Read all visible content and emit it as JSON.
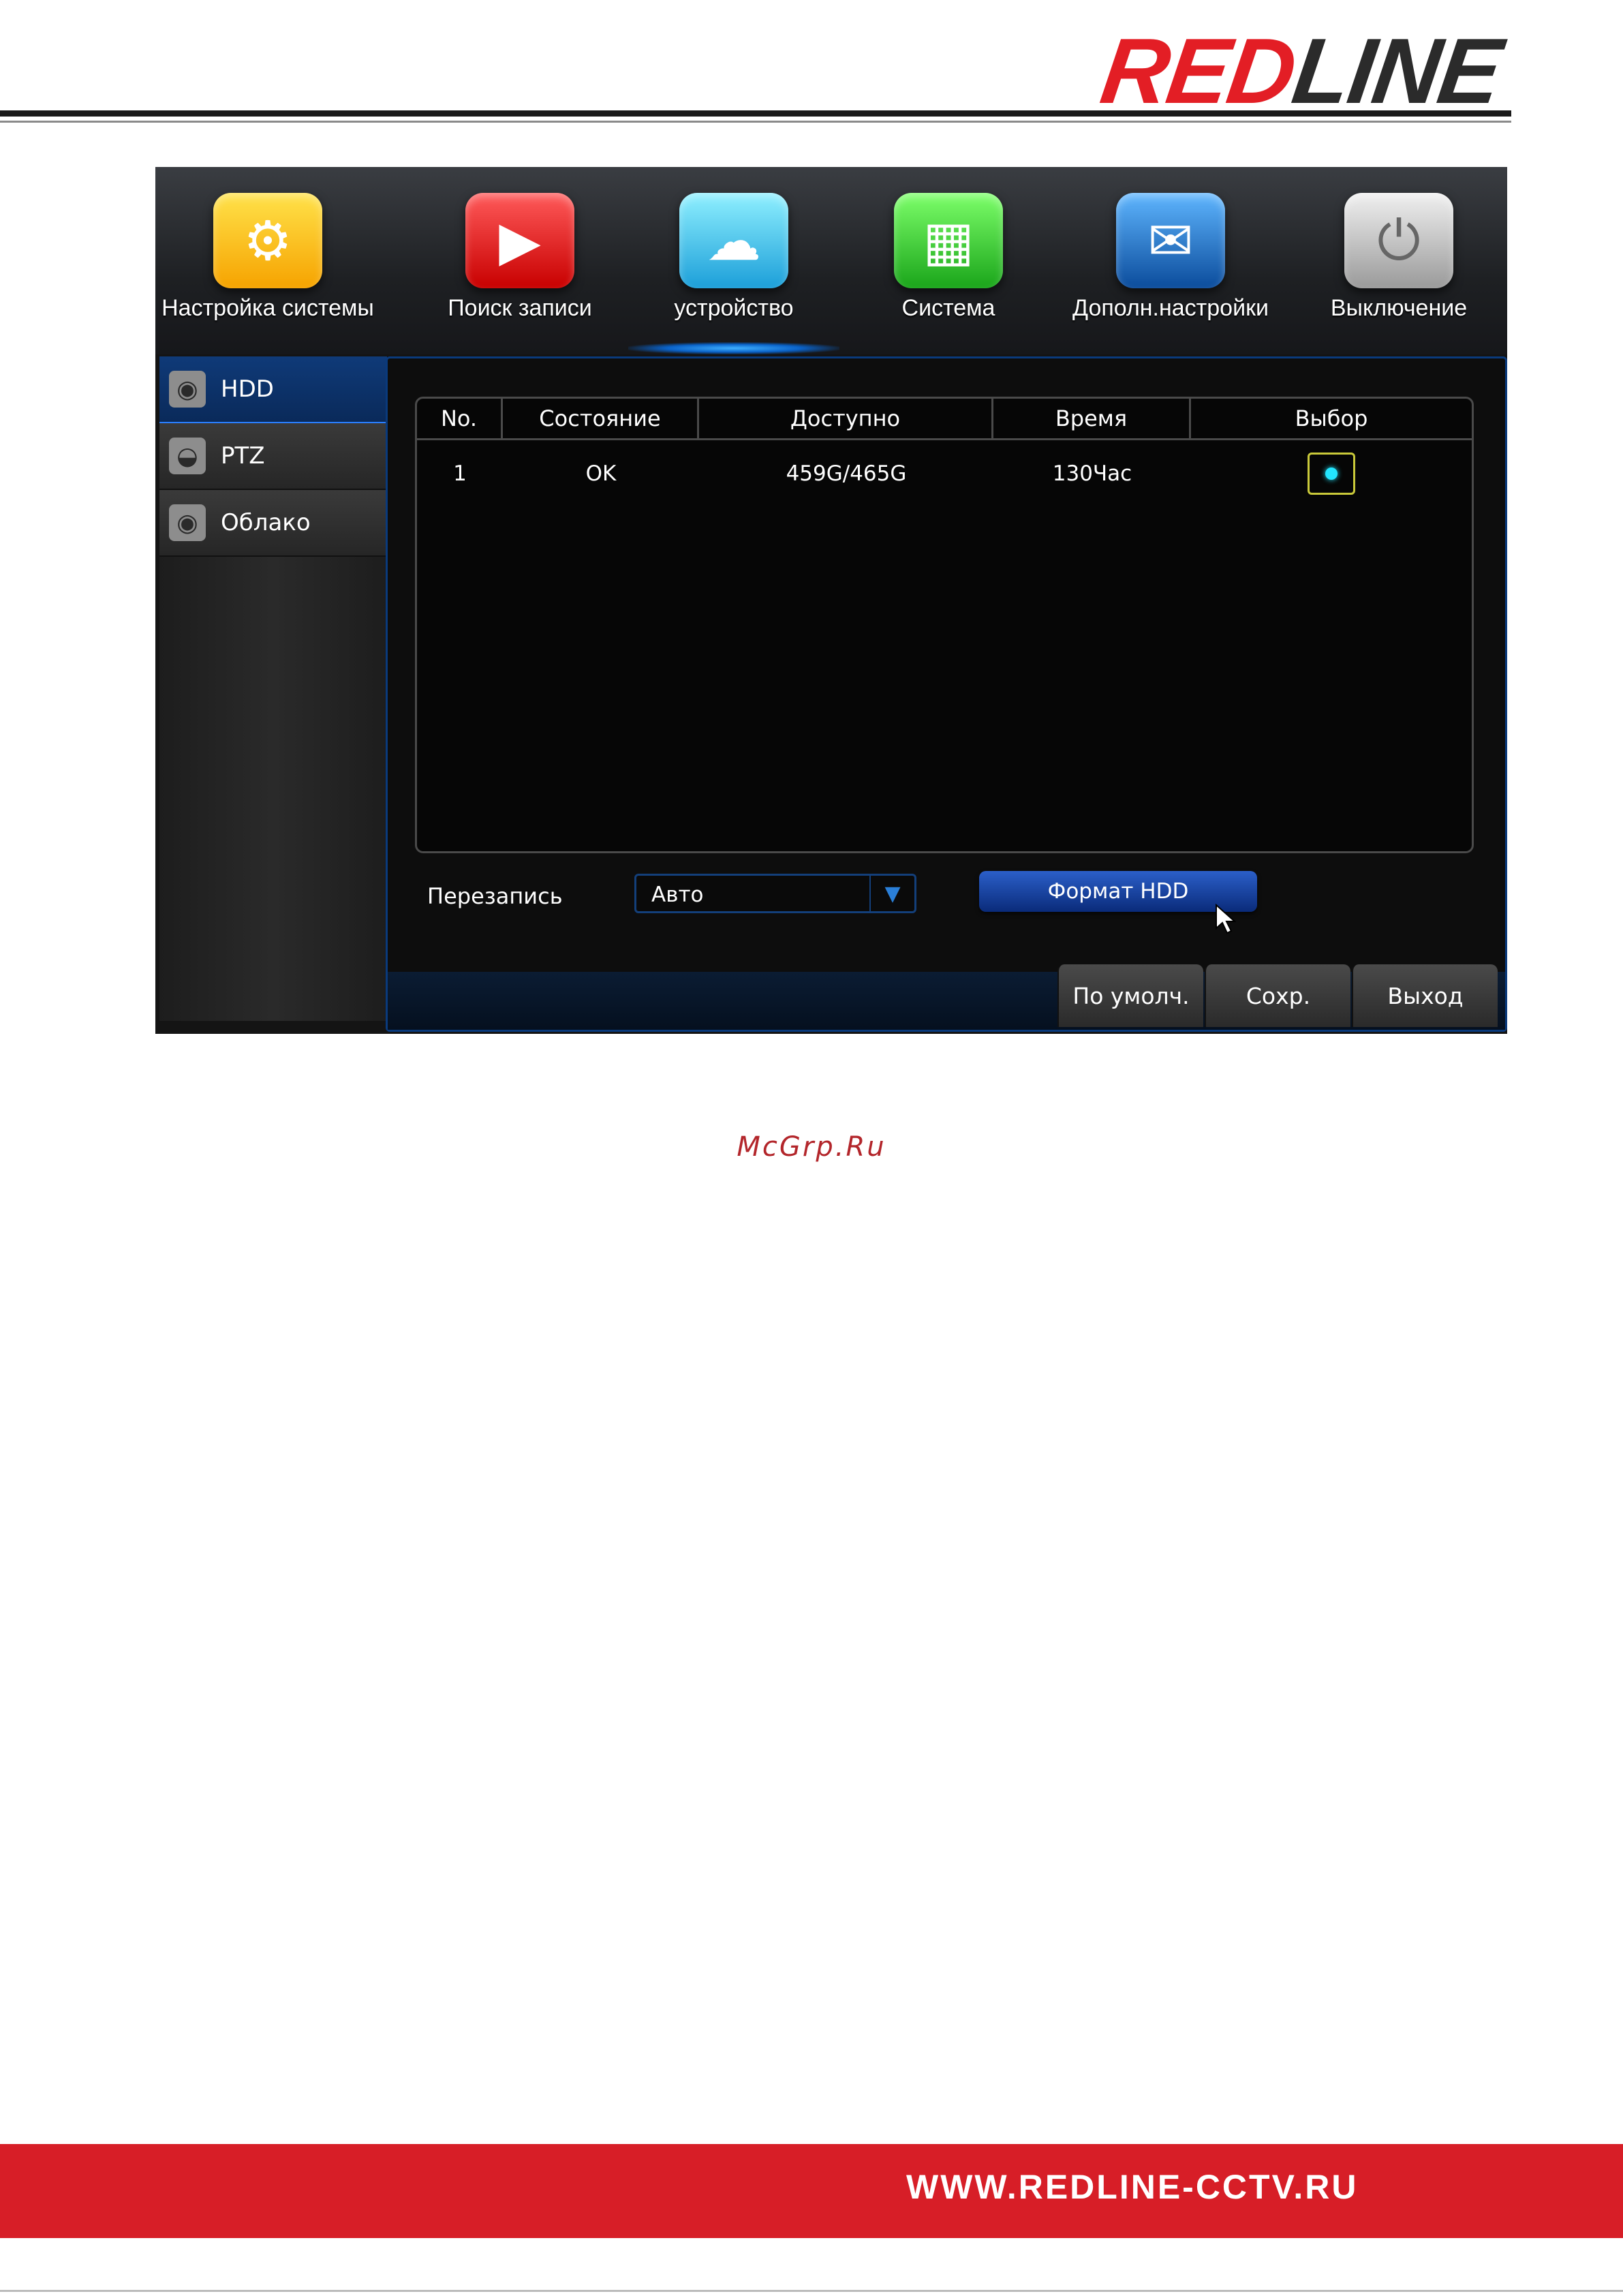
{
  "brand": {
    "part1": "RED",
    "part2": "LINE"
  },
  "tabs": [
    {
      "label": "Настройка системы",
      "icon": "gears-wrench-icon",
      "glyph": "⚙"
    },
    {
      "label": "Поиск записи",
      "icon": "video-search-icon",
      "glyph": "▶"
    },
    {
      "label": "устройство",
      "icon": "cloud-server-icon",
      "glyph": "☁",
      "active": true
    },
    {
      "label": "Система",
      "icon": "calendar-info-icon",
      "glyph": "▦"
    },
    {
      "label": "Дополн.настройки",
      "icon": "advanced-email-icon",
      "glyph": "✉"
    },
    {
      "label": "Выключение",
      "icon": "power-icon",
      "glyph": "⏻"
    }
  ],
  "sidebar": {
    "items": [
      {
        "label": "HDD",
        "icon": "hdd-icon",
        "glyph": "◉",
        "active": true
      },
      {
        "label": "PTZ",
        "icon": "ptz-camera-icon",
        "glyph": "◒"
      },
      {
        "label": "Облако",
        "icon": "cloud-hdd-icon",
        "glyph": "◉"
      }
    ]
  },
  "table": {
    "headers": [
      "No.",
      "Состояние",
      "Доступно",
      "Время",
      "Выбор"
    ],
    "rows": [
      {
        "no": "1",
        "status": "OK",
        "available": "459G/465G",
        "time": "130Час",
        "selected": true
      }
    ]
  },
  "overwrite": {
    "label": "Перезапись",
    "value": "Авто"
  },
  "format_button": "Формат HDD",
  "footer_buttons": {
    "default": "По умолч.",
    "save": "Сохр.",
    "exit": "Выход"
  },
  "watermark": "McGrp.Ru",
  "footer_url": "WWW.REDLINE-CCTV.RU",
  "colors": {
    "brand_red": "#e31e25",
    "accent_blue": "#2a7fff",
    "select_dot": "#23e6ff"
  }
}
